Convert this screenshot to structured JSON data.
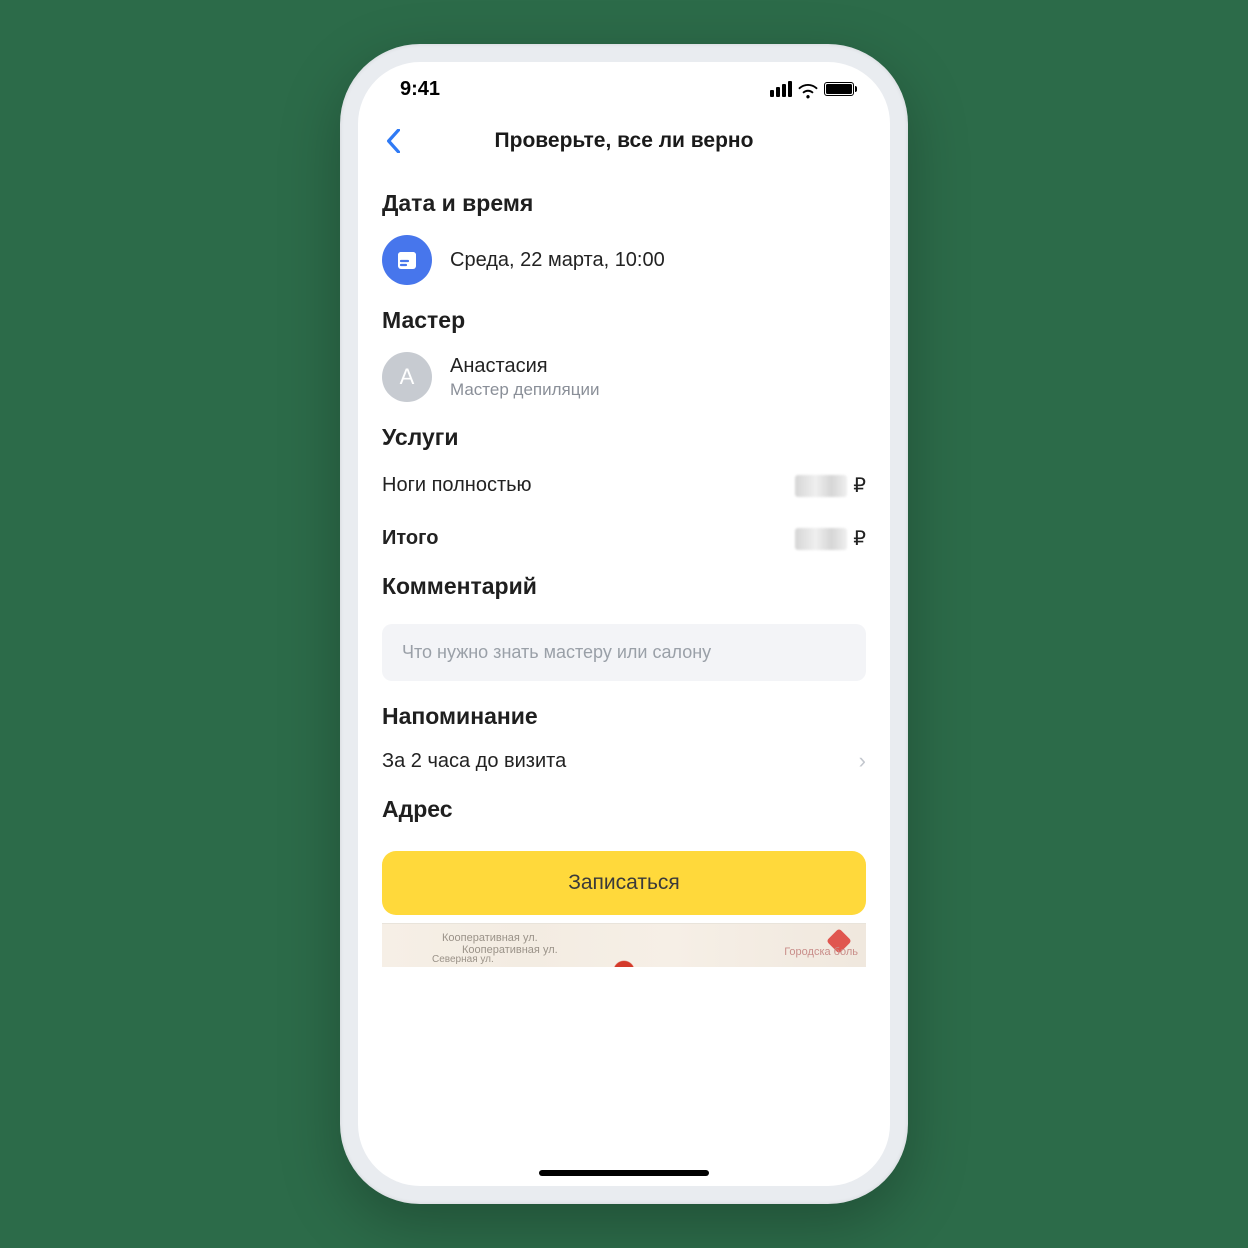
{
  "status": {
    "time": "9:41"
  },
  "header": {
    "title": "Проверьте, все ли верно"
  },
  "datetime": {
    "section_title": "Дата и время",
    "value": "Среда, 22 марта, 10:00"
  },
  "master": {
    "section_title": "Мастер",
    "avatar_initial": "А",
    "name": "Анастасия",
    "role": "Мастер депиляции"
  },
  "services": {
    "section_title": "Услуги",
    "items": [
      {
        "name": "Ноги полностью",
        "currency": "₽"
      }
    ],
    "total_label": "Итого",
    "total_currency": "₽"
  },
  "comment": {
    "section_title": "Комментарий",
    "placeholder": "Что нужно знать мастеру или салону"
  },
  "reminder": {
    "section_title": "Напоминание",
    "value": "За 2 часа до визита"
  },
  "address": {
    "section_title": "Адрес"
  },
  "cta": {
    "label": "Записаться"
  },
  "map": {
    "street1": "Кооперативная ул.",
    "street2": "Кооперативная ул.",
    "street3": "Северная ул.",
    "poi_top": "",
    "poi_label": "Городска\nболь"
  }
}
